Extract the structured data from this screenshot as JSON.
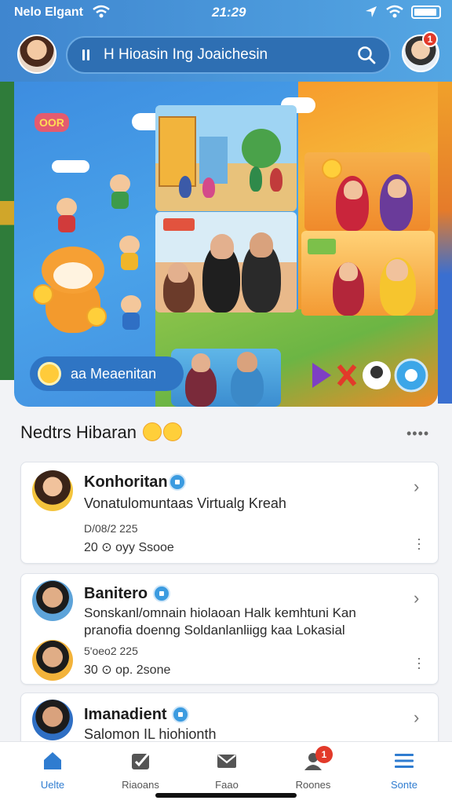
{
  "status_bar": {
    "carrier": "Nelo Elgant",
    "time": "21:29"
  },
  "header": {
    "search_text": "H Hioasin Ing Joaichesin",
    "notification_count": "1"
  },
  "banner": {
    "pill_text": "aa Meaenitan",
    "badge_text": "OOR"
  },
  "section": {
    "title": "Nedtrs Hibaran",
    "more": "••••"
  },
  "cards": [
    {
      "name": "Konhoritan",
      "desc": [
        "Vonatulomuntaas Virtualg Kreah"
      ],
      "meta1": "D/08/2 225",
      "meta2": "20 ⊙ oyy Ssooe"
    },
    {
      "name": "Banitero",
      "desc": [
        "Sonskanl/omnain hiolaoan Halk kemhtuni Kan",
        "pranofia doenng Soldanlanliigg kaa Lokasial"
      ],
      "meta1": "5'oeo2 225",
      "meta2": "30 ⊙ op. 2sone"
    },
    {
      "name": "Imanadient",
      "desc": [
        "Salomon IL hiohionth"
      ],
      "meta1": "",
      "meta2": ""
    }
  ],
  "bottom_nav": [
    {
      "label": "Uelte",
      "icon": "home-icon",
      "active": true
    },
    {
      "label": "Riaoans",
      "icon": "check-square-icon",
      "active": false
    },
    {
      "label": "Faao",
      "icon": "mail-icon",
      "active": false
    },
    {
      "label": "Roones",
      "icon": "person-icon",
      "active": false,
      "badge": "1"
    },
    {
      "label": "Sonte",
      "icon": "menu-icon",
      "active": true
    }
  ],
  "colors": {
    "primary": "#3f86cf",
    "accent": "#2f7cd0",
    "badge": "#e23a2a"
  }
}
